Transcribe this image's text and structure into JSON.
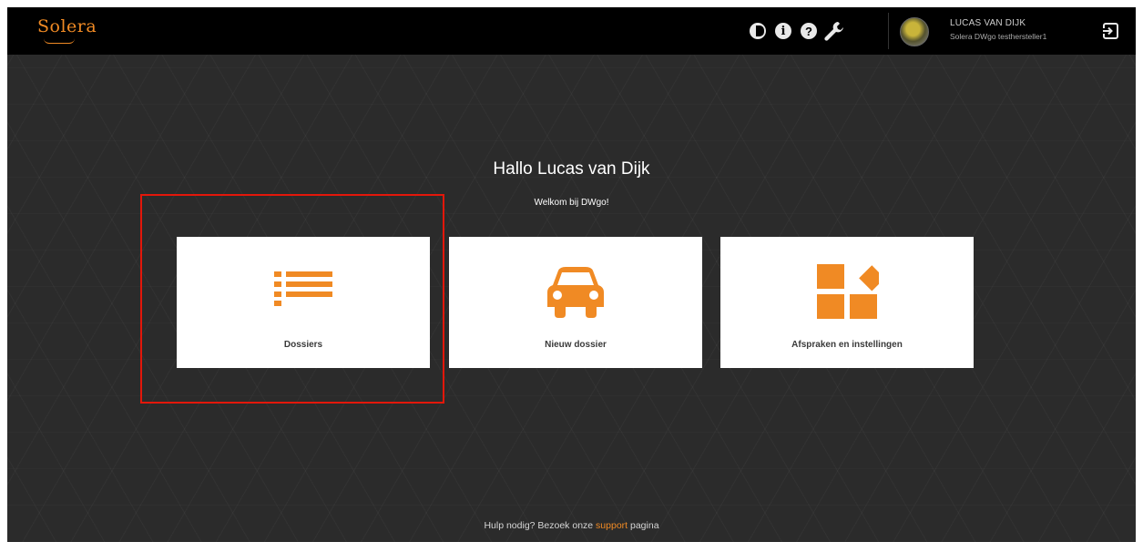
{
  "header": {
    "logo_text": "Solera",
    "icons": [
      "contrast-icon",
      "info-icon",
      "help-icon",
      "wrench-icon",
      "logout-icon"
    ],
    "info_glyph": "i",
    "help_glyph": "?",
    "user": {
      "name": "LUCAS VAN DIJK",
      "subtitle": "Solera DWgo testhersteller1"
    }
  },
  "main": {
    "greeting": "Hallo Lucas van Dijk",
    "welcome": "Welkom bij DWgo!",
    "tiles": [
      {
        "label": "Dossiers",
        "icon": "list-icon"
      },
      {
        "label": "Nieuw dossier",
        "icon": "car-icon"
      },
      {
        "label": "Afspraken en instellingen",
        "icon": "shapes-icon"
      }
    ]
  },
  "footer": {
    "prefix": "Hulp nodig? Bezoek onze",
    "link": "support",
    "suffix": "pagina"
  },
  "colors": {
    "accent": "#f08a24",
    "topbar": "#000000",
    "background": "#2b2b2b",
    "tile": "#ffffff",
    "highlight": "#e3170a"
  }
}
